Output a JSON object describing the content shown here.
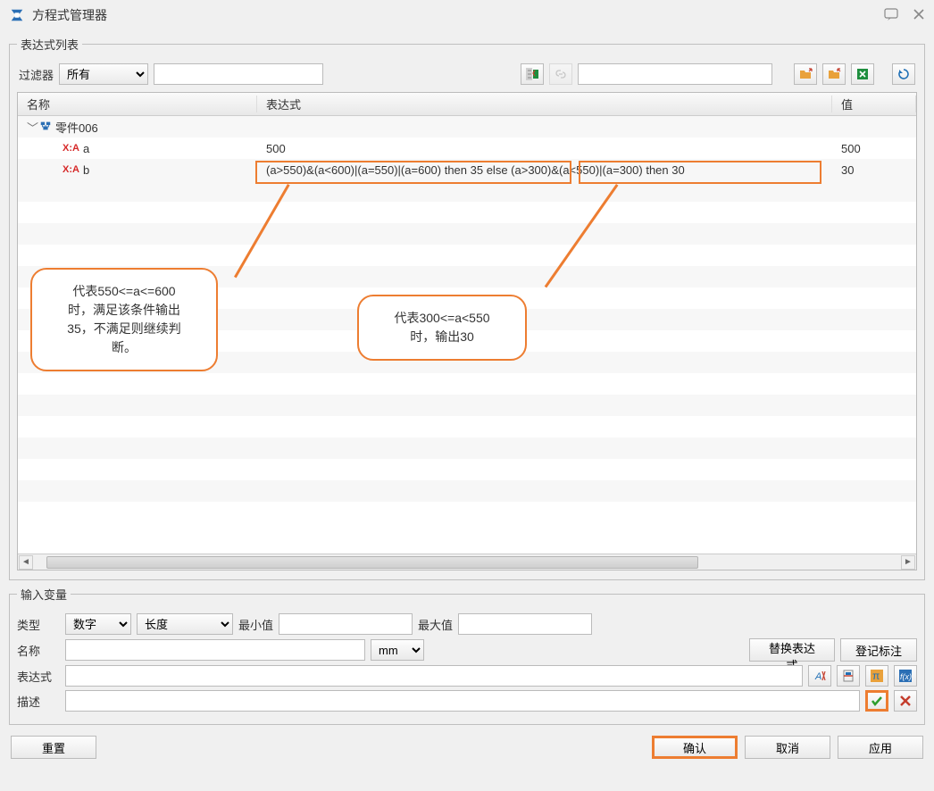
{
  "title": "方程式管理器",
  "window_icons": {
    "help": "help",
    "close": "close"
  },
  "groups": {
    "expr_list": "表达式列表",
    "input_vars": "输入变量"
  },
  "filter": {
    "label": "过滤器",
    "selected": "所有",
    "search_value": ""
  },
  "columns": {
    "name": "名称",
    "expr": "表达式",
    "value": "值"
  },
  "tree": {
    "root": {
      "label": "零件006",
      "expanded": true
    },
    "rows": [
      {
        "var_prefix": "X:A",
        "name": "a",
        "expr": "500",
        "value": "500"
      },
      {
        "var_prefix": "X:A",
        "name": "b",
        "expr": "(a>550)&(a<600)|(a=550)|(a=600) then 35 else (a>300)&(a<550)|(a=300) then 30",
        "value": "30"
      }
    ]
  },
  "annotations": {
    "box1_text": "(a>550)&(a<600)|(a=550)|(a=600) then 35 else",
    "box2_text": "(a>300)&(a<550)|(a=300) then 30",
    "callout1_lines": [
      "代表550<=a<=600",
      "时，满足该条件输出",
      "35，不满足则继续判",
      "断。"
    ],
    "callout2_lines": [
      "代表300<=a<550",
      "时，输出30"
    ]
  },
  "input_vars": {
    "type_label": "类型",
    "type_value": "数字",
    "dim_value": "长度",
    "min_label": "最小值",
    "min_value": "",
    "max_label": "最大值",
    "max_value": "",
    "name_label": "名称",
    "name_value": "",
    "unit_value": "mm",
    "replace_btn": "替换表达式",
    "annotate_btn": "登记标注",
    "expr_label": "表达式",
    "expr_value": "",
    "desc_label": "描述",
    "desc_value": ""
  },
  "buttons": {
    "reset": "重置",
    "ok": "确认",
    "cancel": "取消",
    "apply": "应用"
  },
  "icon_names": {
    "import_excel": "import-excel-icon",
    "link": "link-icon",
    "folder_open": "folder-open-icon",
    "folder_close": "folder-close-icon",
    "excel": "excel-icon",
    "refresh": "refresh-icon",
    "a_over_x": "var-icon",
    "strikethrough": "strike-icon",
    "pi": "pi-icon",
    "fx": "fx-icon",
    "check": "check-icon",
    "cross": "cross-icon"
  }
}
